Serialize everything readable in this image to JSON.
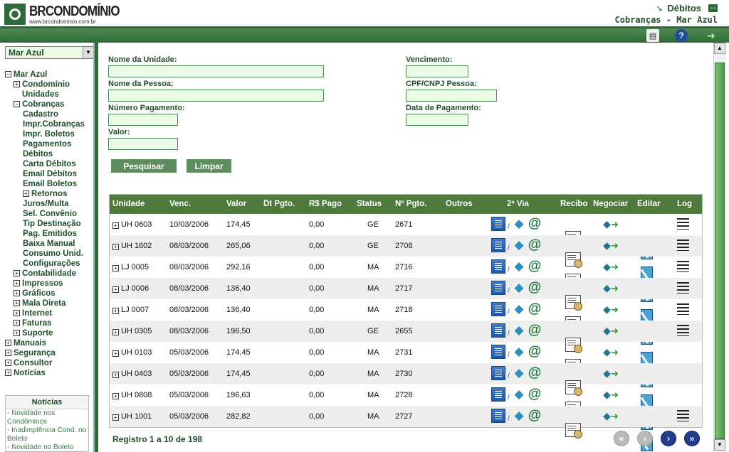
{
  "header": {
    "logo_text": "BRCONDOMÍNIO",
    "logo_url": "www.brcondominio.com.br",
    "title": "Débitos",
    "subtitle": "Cobranças - Mar Azul"
  },
  "toolbar": {
    "print_icon": "printer-icon",
    "help_icon": "help-icon",
    "exit_icon": "exit-icon"
  },
  "sidebar": {
    "condominium_select": "Mar Azul",
    "tree": [
      {
        "label": "Mar Azul",
        "level": 0,
        "toggle": "−"
      },
      {
        "label": "Condomínio Unidades",
        "level": 1,
        "toggle": "+"
      },
      {
        "label": "Cobranças",
        "level": 1,
        "toggle": "−"
      },
      {
        "label": "Cadastro",
        "level": 2,
        "toggle": ""
      },
      {
        "label": "Impr.Cobranças",
        "level": 2,
        "toggle": ""
      },
      {
        "label": "Impr. Boletos",
        "level": 2,
        "toggle": ""
      },
      {
        "label": "Pagamentos",
        "level": 2,
        "toggle": ""
      },
      {
        "label": "Débitos",
        "level": 2,
        "toggle": ""
      },
      {
        "label": "Carta Débitos",
        "level": 2,
        "toggle": ""
      },
      {
        "label": "Email Débitos",
        "level": 2,
        "toggle": ""
      },
      {
        "label": "Email Boletos",
        "level": 2,
        "toggle": ""
      },
      {
        "label": "Retornos",
        "level": 2,
        "toggle": "+"
      },
      {
        "label": "Juros/Multa",
        "level": 2,
        "toggle": ""
      },
      {
        "label": "Sel. Convênio",
        "level": 2,
        "toggle": ""
      },
      {
        "label": "Tip Destinação",
        "level": 2,
        "toggle": ""
      },
      {
        "label": "Pag. Emitidos",
        "level": 2,
        "toggle": ""
      },
      {
        "label": "Baixa Manual",
        "level": 2,
        "toggle": ""
      },
      {
        "label": "Consumo Unid.",
        "level": 2,
        "toggle": ""
      },
      {
        "label": "Configurações",
        "level": 2,
        "toggle": ""
      },
      {
        "label": "Contabilidade",
        "level": 1,
        "toggle": "+"
      },
      {
        "label": "Impressos",
        "level": 1,
        "toggle": "+"
      },
      {
        "label": "Gráficos",
        "level": 1,
        "toggle": "+"
      },
      {
        "label": "Mala Direta",
        "level": 1,
        "toggle": "+"
      },
      {
        "label": "Internet",
        "level": 1,
        "toggle": "+"
      },
      {
        "label": "Faturas",
        "level": 1,
        "toggle": "+"
      },
      {
        "label": "Suporte",
        "level": 1,
        "toggle": "+"
      },
      {
        "label": "Manuais",
        "level": 0,
        "toggle": "+"
      },
      {
        "label": "Segurança",
        "level": 0,
        "toggle": "+"
      },
      {
        "label": "Consultor",
        "level": 0,
        "toggle": "+"
      },
      {
        "label": "Notícias",
        "level": 0,
        "toggle": "+"
      }
    ],
    "news": {
      "title": "Notícias",
      "items": [
        "- Novidade nos Condôminos",
        "- Inadimplência Cond. no Boleto",
        "- Novidade no Boleto"
      ]
    }
  },
  "form": {
    "nome_unidade_label": "Nome da Unidade:",
    "nome_pessoa_label": "Nome da Pessoa:",
    "numero_pagamento_label": "Número Pagamento:",
    "valor_label": "Valor:",
    "vencimento_label": "Vencimento:",
    "cpf_label": "CPF/CNPJ Pessoa:",
    "data_pagamento_label": "Data de Pagamento:",
    "pesquisar": "Pesquisar",
    "limpar": "Limpar"
  },
  "table": {
    "headers": [
      "Unidade",
      "Venc.",
      "Valor",
      "Dt Pgto.",
      "R$ Pago",
      "Status",
      "Nº Pgto.",
      "Outros",
      "2ª Via",
      "Recibo",
      "Negociar",
      "Editar",
      "Log"
    ],
    "rows": [
      {
        "unidade": "UH 0603",
        "venc": "10/03/2006",
        "valor": "174,45",
        "dt": "",
        "pago": "0,00",
        "status": "GE",
        "num": "2671",
        "log": true
      },
      {
        "unidade": "UH 1602",
        "venc": "08/03/2006",
        "valor": "265,06",
        "dt": "",
        "pago": "0,00",
        "status": "GE",
        "num": "2708",
        "log": true
      },
      {
        "unidade": "LJ 0005",
        "venc": "08/03/2006",
        "valor": "292,16",
        "dt": "",
        "pago": "0,00",
        "status": "MA",
        "num": "2716",
        "log": true
      },
      {
        "unidade": "LJ 0006",
        "venc": "08/03/2006",
        "valor": "136,40",
        "dt": "",
        "pago": "0,00",
        "status": "MA",
        "num": "2717",
        "log": true
      },
      {
        "unidade": "LJ 0007",
        "venc": "08/03/2006",
        "valor": "136,40",
        "dt": "",
        "pago": "0,00",
        "status": "MA",
        "num": "2718",
        "log": true
      },
      {
        "unidade": "UH 0305",
        "venc": "08/03/2006",
        "valor": "196,50",
        "dt": "",
        "pago": "0,00",
        "status": "GE",
        "num": "2655",
        "log": true
      },
      {
        "unidade": "UH 0103",
        "venc": "05/03/2006",
        "valor": "174,45",
        "dt": "",
        "pago": "0,00",
        "status": "MA",
        "num": "2731",
        "log": false
      },
      {
        "unidade": "UH 0403",
        "venc": "05/03/2006",
        "valor": "174,45",
        "dt": "",
        "pago": "0,00",
        "status": "MA",
        "num": "2730",
        "log": false
      },
      {
        "unidade": "UH 0808",
        "venc": "05/03/2006",
        "valor": "196,63",
        "dt": "",
        "pago": "0,00",
        "status": "MA",
        "num": "2728",
        "log": false
      },
      {
        "unidade": "UH 1001",
        "venc": "05/03/2006",
        "valor": "282,82",
        "dt": "",
        "pago": "0,00",
        "status": "MA",
        "num": "2727",
        "log": true
      }
    ]
  },
  "footer": {
    "records": "Registro 1 a 10 de 198",
    "pager": [
      "first-page-icon",
      "prev-page-icon",
      "next-page-icon",
      "last-page-icon"
    ]
  },
  "colors": {
    "brand_green": "#2f6a3a",
    "header_green": "#4e7a3c",
    "input_bg": "#e9fbe4",
    "pager_active": "#233c8c"
  }
}
